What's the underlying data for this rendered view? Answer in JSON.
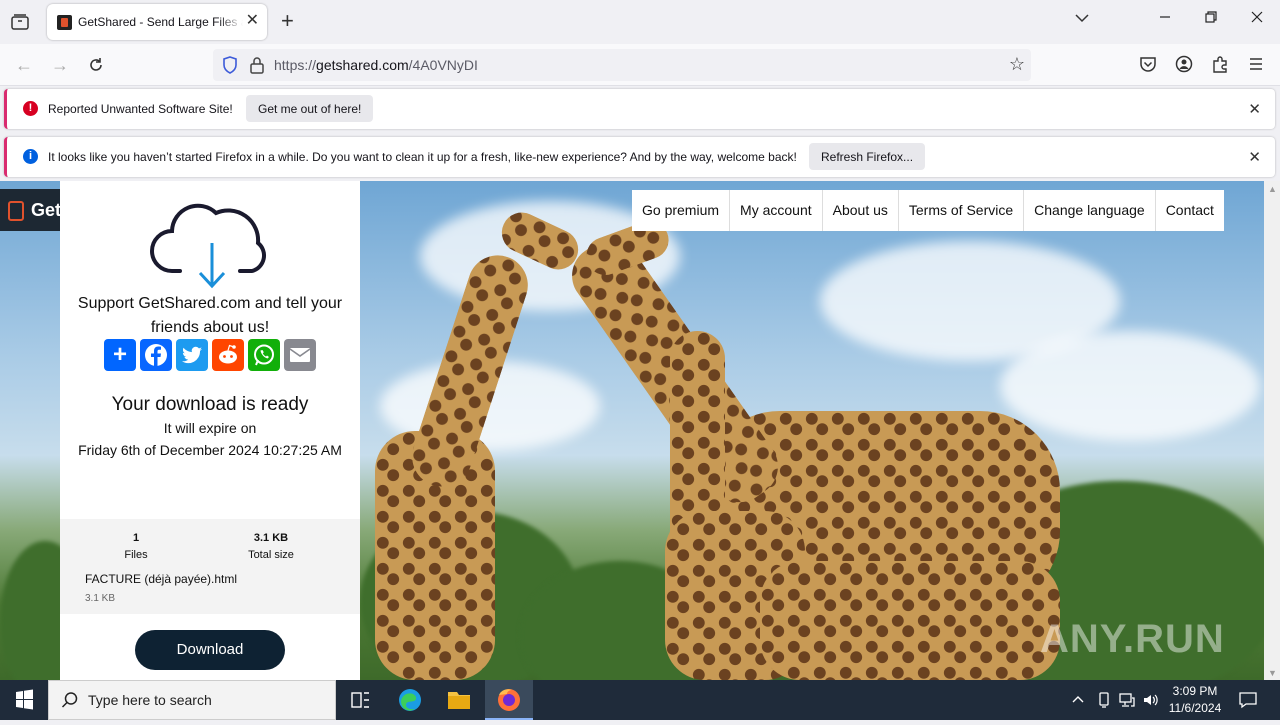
{
  "browser": {
    "tab_title": "GetShared - Send Large Files and",
    "url_prefix": "https://",
    "url_domain": "getshared.com",
    "url_path": "/4A0VNyDI"
  },
  "notifications": {
    "unwanted": {
      "message": "Reported Unwanted Software Site!",
      "button": "Get me out of here!"
    },
    "refresh": {
      "message": "It looks like you haven’t started Firefox in a while. Do you want to clean it up for a fresh, like-new experience? And by the way, welcome back!",
      "button": "Refresh Firefox..."
    }
  },
  "site": {
    "logo_text": "Get",
    "menu": [
      "Go premium",
      "My account",
      "About us",
      "Terms of Service",
      "Change language",
      "Contact"
    ],
    "support_line1": "Support GetShared.com and tell your",
    "support_line2": "friends about us!",
    "share_icons": [
      "addtoany-icon",
      "facebook-icon",
      "twitter-icon",
      "reddit-icon",
      "whatsapp-icon",
      "email-icon"
    ],
    "ready": "Your download is ready",
    "expire_label": "It will expire on",
    "expire_date": "Friday 6th of December 2024 10:27:25 AM",
    "files_count": "1",
    "files_label": "Files",
    "total_size": "3.1 KB",
    "total_label": "Total size",
    "file_name": "FACTURE (déjà payée).html",
    "file_size": "3.1 KB",
    "download": "Download",
    "watermark": "ANY.RUN"
  },
  "taskbar": {
    "search_placeholder": "Type here to search",
    "time": "3:09 PM",
    "date": "11/6/2024"
  },
  "colors": {
    "alert_red": "#d70022",
    "info_blue": "#0060df",
    "download_bg": "#0e2233",
    "taskbar": "#1f2b3a"
  }
}
